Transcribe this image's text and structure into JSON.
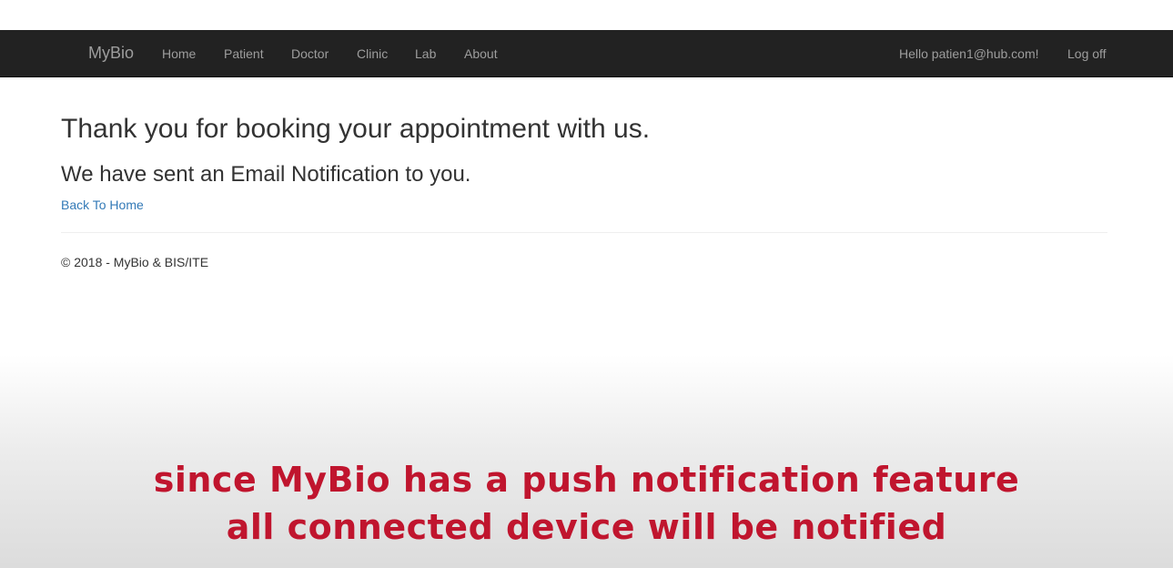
{
  "navbar": {
    "brand": "MyBio",
    "links": [
      "Home",
      "Patient",
      "Doctor",
      "Clinic",
      "Lab",
      "About"
    ],
    "greeting": "Hello patien1@hub.com!",
    "logoff": "Log off"
  },
  "main": {
    "heading": "Thank you for booking your appointment with us.",
    "subheading": "We have sent an Email Notification to you.",
    "back_link": "Back To Home"
  },
  "footer": {
    "text": "© 2018 - MyBio & BIS/ITE"
  },
  "caption": {
    "line1": "since MyBio has a push notification feature",
    "line2": "all connected device will be notified",
    "color": "#c0152e"
  },
  "colors": {
    "navbar_bg": "#222222",
    "nav_text": "#9d9d9d",
    "link": "#337ab7"
  }
}
